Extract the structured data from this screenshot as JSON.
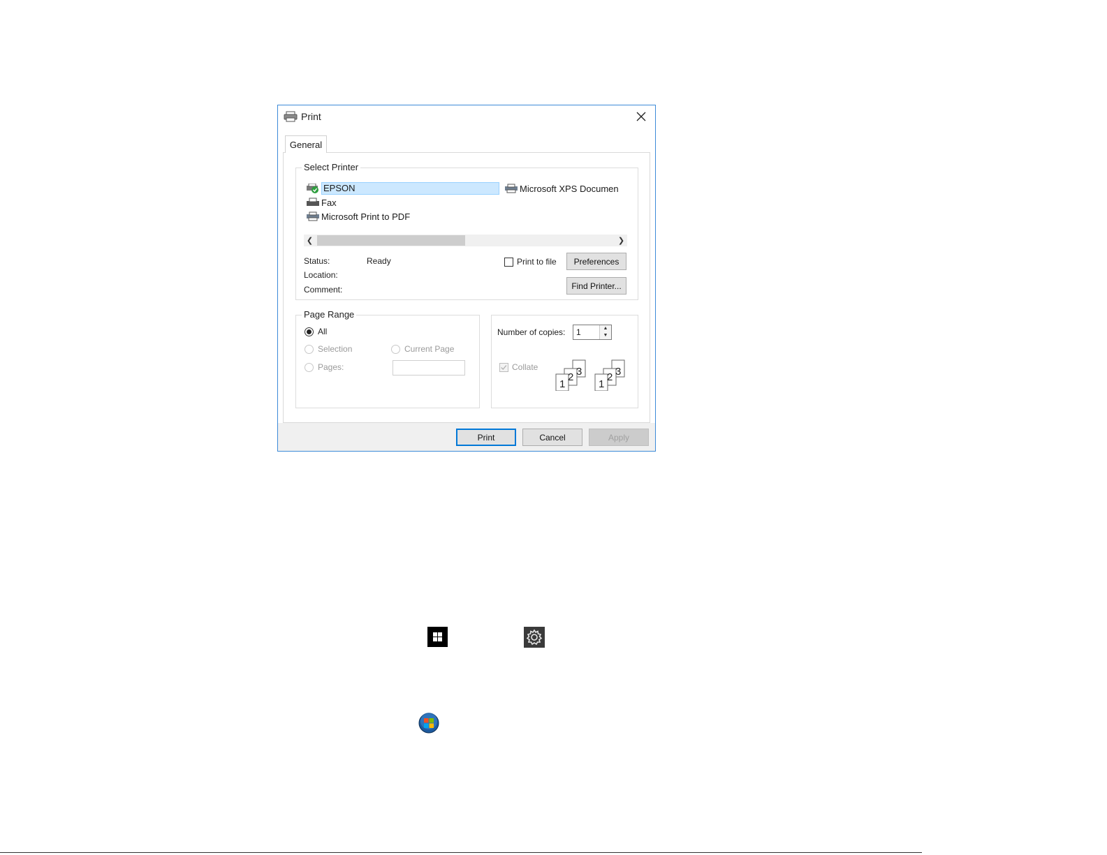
{
  "dialog": {
    "title": "Print",
    "tab_general": "General"
  },
  "select_printer": {
    "group_label": "Select Printer",
    "printers": [
      "EPSON",
      "Microsoft XPS Documen",
      "Fax",
      "Microsoft Print to PDF"
    ],
    "selected": "EPSON"
  },
  "status": {
    "status_label": "Status:",
    "status_value": "Ready",
    "location_label": "Location:",
    "comment_label": "Comment:",
    "print_to_file_label": "Print to file",
    "preferences_label": "Preferences",
    "find_printer_label": "Find Printer..."
  },
  "page_range": {
    "group_label": "Page Range",
    "all_label": "All",
    "selection_label": "Selection",
    "current_page_label": "Current Page",
    "pages_label": "Pages:"
  },
  "copies": {
    "number_of_copies_label": "Number of copies:",
    "copies_value": "1",
    "collate_label": "Collate",
    "collate_digits": [
      "1",
      "2",
      "3"
    ]
  },
  "buttons": {
    "print_label": "Print",
    "cancel_label": "Cancel",
    "apply_label": "Apply"
  },
  "colors": {
    "accent": "#0078d7",
    "selection_bg": "#cce8ff"
  }
}
